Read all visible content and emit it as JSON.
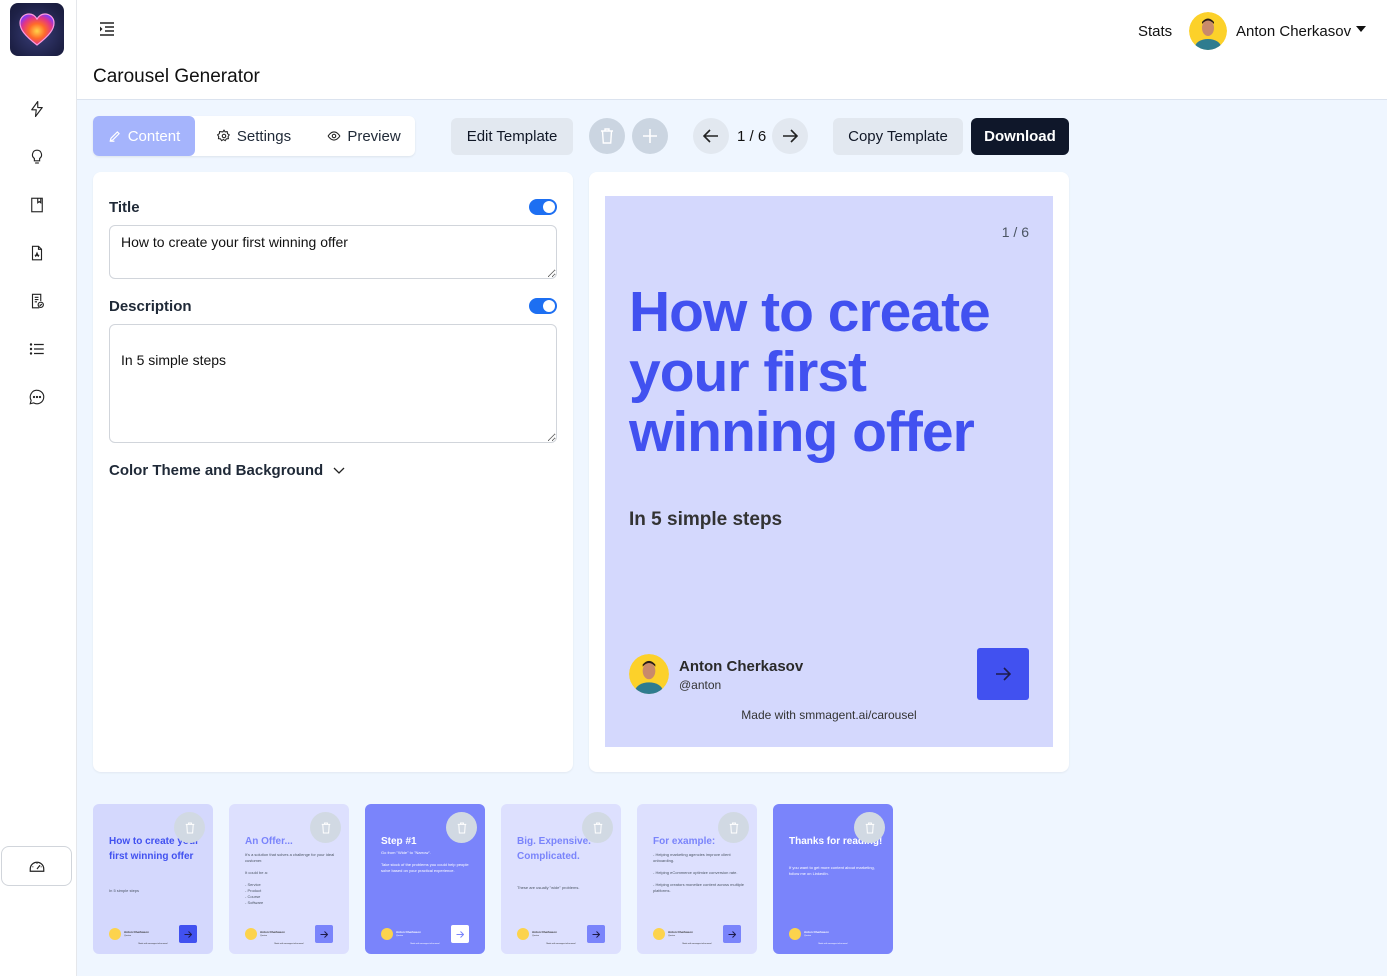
{
  "app": {
    "page_title": "Carousel Generator"
  },
  "header": {
    "stats_label": "Stats",
    "user_name": "Anton Cherkasov"
  },
  "sidebar": {
    "items": [
      {
        "icon": "lightning-icon",
        "label": "Generate"
      },
      {
        "icon": "lightbulb-icon",
        "label": "Ideas"
      },
      {
        "icon": "bookmark-icon",
        "label": "Saved"
      },
      {
        "icon": "pdf-file-icon",
        "label": "PDF"
      },
      {
        "icon": "document-check-icon",
        "label": "Templates"
      },
      {
        "icon": "list-icon",
        "label": "List"
      },
      {
        "icon": "chat-icon",
        "label": "Chat"
      }
    ],
    "bottom_icon": "gauge-icon"
  },
  "toolbar": {
    "tabs": [
      {
        "label": "Content",
        "icon": "pen-icon",
        "active": true
      },
      {
        "label": "Settings",
        "icon": "gear-icon",
        "active": false
      },
      {
        "label": "Preview",
        "icon": "eye-icon",
        "active": false
      }
    ],
    "edit_template_label": "Edit Template",
    "page_indicator": "1 / 6",
    "copy_template_label": "Copy Template",
    "download_label": "Download"
  },
  "editor": {
    "title_label": "Title",
    "title_enabled": true,
    "title_value": "How to create your first winning offer",
    "description_label": "Description",
    "description_enabled": true,
    "description_value": "\nIn 5 simple steps",
    "color_theme_label": "Color Theme and Background"
  },
  "preview": {
    "slide_count": "1 / 6",
    "title": "How to create your first winning offer",
    "description": "In 5 simple steps",
    "author_name": "Anton Cherkasov",
    "author_handle": "@anton",
    "footer": "Made with smmagent.ai/carousel",
    "accent_color": "#4151f0",
    "background_color": "#d4d8fd"
  },
  "thumbnails": [
    {
      "title": "How to create your first winning offer",
      "body": "In 5 simple steps",
      "theme": "light1"
    },
    {
      "title": "An Offer...",
      "body": "It's a solution that solves a challenge for your ideal customer.\n\nIt could be a:\n\n- Service\n- Product\n- Course\n- Software",
      "theme": "light2"
    },
    {
      "title": "Step #1",
      "body": "Go from \"Wide\" to \"Narrow\".\n\nTake stock of the problems you could help people solve based on your practical experience.",
      "theme": "dark"
    },
    {
      "title": "Big. Expensive. Complicated.",
      "body": "These are usually \"wide\" problems.",
      "theme": "light2"
    },
    {
      "title": "For example:",
      "body": "- Helping marketing agencies improve client onboarding.\n\n- Helping eCommerce optimize conversion rate.\n\n- Helping creators monetize content across multiple platforms.",
      "theme": "light2"
    },
    {
      "title": "Thanks for reading!",
      "body": "If you want to get more content about marketing, follow me on LinkedIn.",
      "theme": "dark"
    }
  ],
  "thumbnail_author": {
    "name": "Anton Cherkasov",
    "handle": "@anton",
    "footer": "Made with smmagent.ai/carousel"
  }
}
